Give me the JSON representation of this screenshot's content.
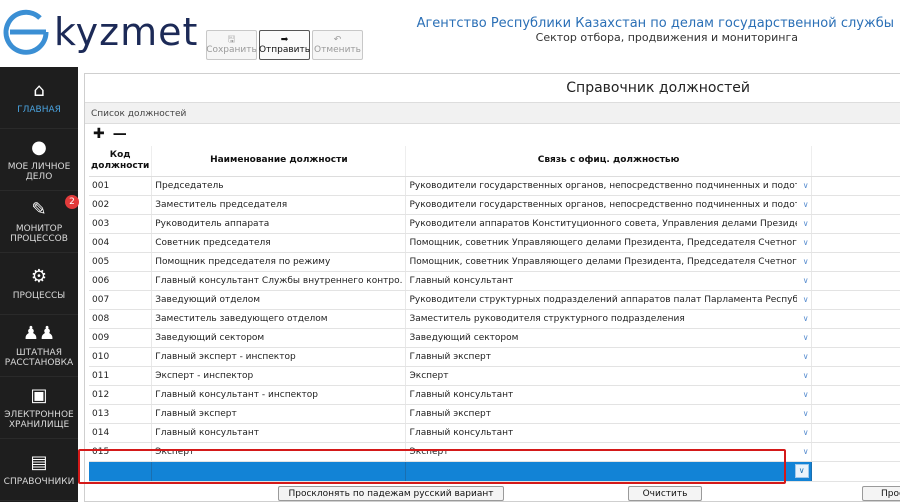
{
  "brand": {
    "logo_text": "kyzmet"
  },
  "toolbar": {
    "save_label": "Сохранить",
    "send_label": "Отправить",
    "cancel_label": "Отменить"
  },
  "agency": {
    "title": "Агентство Республики Казахстан по делам государственной службы",
    "subtitle": "Сектор отбора, продвижения и мониторинга"
  },
  "sidebar": {
    "items": [
      {
        "label": "ГЛАВНАЯ",
        "icon": "home-icon"
      },
      {
        "label": "МОЕ ЛИЧНОЕ ДЕЛО",
        "icon": "user-file-icon"
      },
      {
        "label": "МОНИТОР ПРОЦЕССОВ",
        "icon": "edit-monitor-icon",
        "badge": "2"
      },
      {
        "label": "ПРОЦЕССЫ",
        "icon": "gears-icon"
      },
      {
        "label": "ШТАТНАЯ РАССТАНОВКА",
        "icon": "people-icon"
      },
      {
        "label": "ЭЛЕКТРОННОЕ ХРАНИЛИЩЕ",
        "icon": "inbox-icon"
      },
      {
        "label": "СПРАВОЧНИКИ",
        "icon": "book-icon"
      }
    ]
  },
  "main": {
    "title": "Справочник должностей",
    "list_label": "Список должностей",
    "columns": {
      "code": "Код должности",
      "name": "Наименование должности",
      "link": "Связь с офиц. должностью"
    },
    "rows": [
      {
        "code": "001",
        "name": "Председатель",
        "link": "Руководители государственных органов, непосредственно подчиненных и подотчетных"
      },
      {
        "code": "002",
        "name": "Заместитель председателя",
        "link": "Руководители государственных органов, непосредственно подчиненных и подотчетных"
      },
      {
        "code": "003",
        "name": "Руководитель аппарата",
        "link": "Руководители аппаратов Конституционного совета, Управления делами Президента Респ"
      },
      {
        "code": "004",
        "name": "Советник председателя",
        "link": "Помощник, советник Управляющего делами Президента, Председателя Счетного комите"
      },
      {
        "code": "005",
        "name": "Помощник председателя по режиму",
        "link": "Помощник, советник Управляющего делами Президента, Председателя Счетного комите"
      },
      {
        "code": "006",
        "name": "Главный консультант Службы внутреннего контро.",
        "link": "Главный консультант"
      },
      {
        "code": "007",
        "name": "Заведующий отделом",
        "link": "Руководители структурных подразделений аппаратов палат Парламента Республики Каза"
      },
      {
        "code": "008",
        "name": "Заместитель заведующего отделом",
        "link": "Заместитель руководителя структурного подразделения"
      },
      {
        "code": "009",
        "name": "Заведующий сектором",
        "link": "Заведующий сектором"
      },
      {
        "code": "010",
        "name": "Главный эксперт - инспектор",
        "link": "Главный эксперт"
      },
      {
        "code": "011",
        "name": "Эксперт - инспектор",
        "link": "Эксперт"
      },
      {
        "code": "012",
        "name": "Главный консультант - инспектор",
        "link": "Главный консультант"
      },
      {
        "code": "013",
        "name": "Главный эксперт",
        "link": "Главный эксперт"
      },
      {
        "code": "014",
        "name": "Главный консультант",
        "link": "Главный консультант"
      },
      {
        "code": "015",
        "name": "Эксперт",
        "link": "Эксперт"
      }
    ]
  },
  "footer": {
    "decline_button": "Просклонять по падежам русский вариант",
    "clear_button": "Очистить",
    "partial_button": "Прос"
  }
}
